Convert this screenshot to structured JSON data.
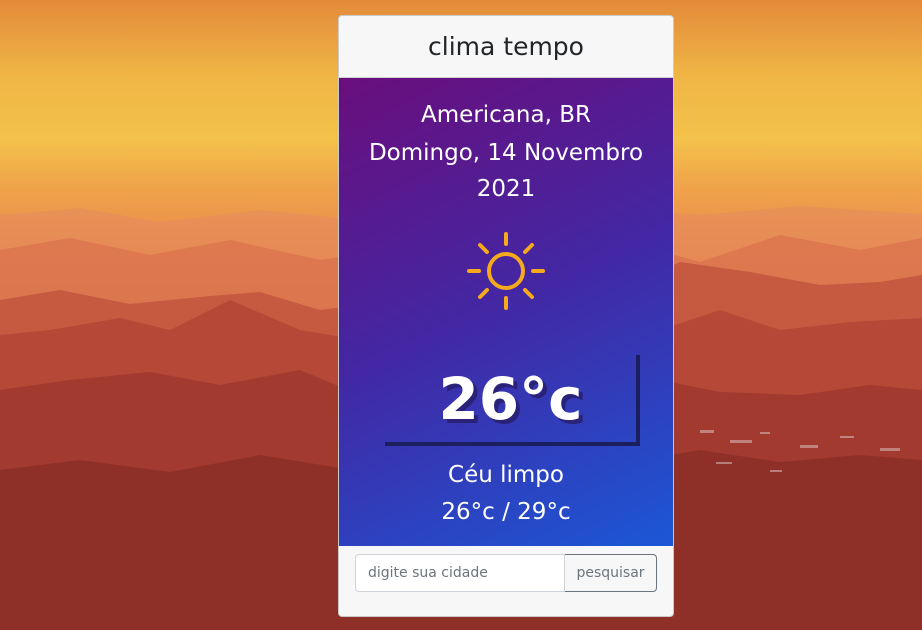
{
  "app": {
    "title": "clima tempo"
  },
  "weather": {
    "location": "Americana, BR",
    "date": "Domingo, 14 Novembro 2021",
    "temperature": "26°c",
    "description": "Céu limpo",
    "min_max": "26°c / 29°c",
    "icon": "sun-icon"
  },
  "search": {
    "placeholder": "digite sua cidade",
    "value": "",
    "button_label": "pesquisar"
  },
  "colors": {
    "sun": "#f5a91c",
    "panel_start": "#6a0e7c",
    "panel_end": "#1b57d6",
    "temp_border": "#1b1f5e"
  }
}
